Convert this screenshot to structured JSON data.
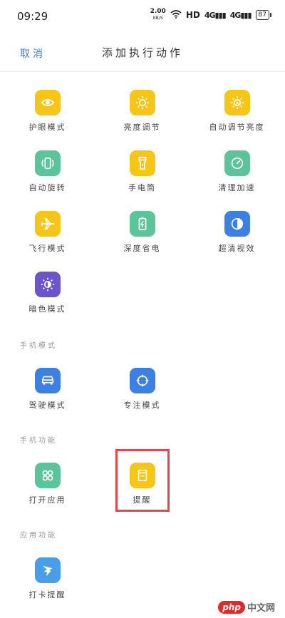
{
  "status_bar": {
    "time": "09:29",
    "speed_value": "2.00",
    "speed_unit": "KB/S",
    "hd": "HD",
    "signal1": "4G",
    "signal2": "4G",
    "battery": "87"
  },
  "nav": {
    "cancel": "取消",
    "title": "添加执行动作"
  },
  "sections": {
    "phone_mode": "手机模式",
    "phone_function": "手机功能",
    "app_function": "应用功能"
  },
  "tiles": {
    "eye_care": "护眼模式",
    "brightness": "亮度调节",
    "auto_brightness": "自动调节亮度",
    "auto_rotate": "自动旋转",
    "flashlight": "手电筒",
    "clean_boost": "清理加速",
    "airplane": "飞行模式",
    "deep_charge": "深度省电",
    "super_vision": "超清视效",
    "dark_mode": "暗色模式",
    "driving_mode": "驾驶模式",
    "focus_mode": "专注模式",
    "open_app": "打开应用",
    "reminder": "提醒",
    "punch_reminder": "打卡提醒"
  },
  "watermark": {
    "logo": "php",
    "text": "中文网"
  },
  "colors": {
    "accent": "#3a7bd5",
    "yellow": "#f5c518",
    "green": "#5cc49a",
    "blue": "#3d80e3",
    "purple": "#6b55c8",
    "highlight": "#e0484c"
  }
}
